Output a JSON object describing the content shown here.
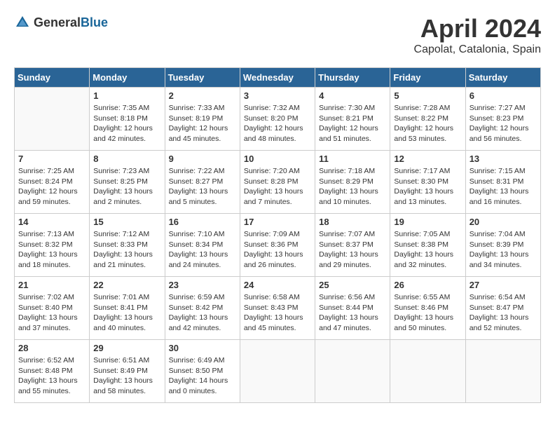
{
  "header": {
    "logo_general": "General",
    "logo_blue": "Blue",
    "month_title": "April 2024",
    "location": "Capolat, Catalonia, Spain"
  },
  "columns": [
    "Sunday",
    "Monday",
    "Tuesday",
    "Wednesday",
    "Thursday",
    "Friday",
    "Saturday"
  ],
  "weeks": [
    [
      {
        "day": "",
        "info": ""
      },
      {
        "day": "1",
        "info": "Sunrise: 7:35 AM\nSunset: 8:18 PM\nDaylight: 12 hours\nand 42 minutes."
      },
      {
        "day": "2",
        "info": "Sunrise: 7:33 AM\nSunset: 8:19 PM\nDaylight: 12 hours\nand 45 minutes."
      },
      {
        "day": "3",
        "info": "Sunrise: 7:32 AM\nSunset: 8:20 PM\nDaylight: 12 hours\nand 48 minutes."
      },
      {
        "day": "4",
        "info": "Sunrise: 7:30 AM\nSunset: 8:21 PM\nDaylight: 12 hours\nand 51 minutes."
      },
      {
        "day": "5",
        "info": "Sunrise: 7:28 AM\nSunset: 8:22 PM\nDaylight: 12 hours\nand 53 minutes."
      },
      {
        "day": "6",
        "info": "Sunrise: 7:27 AM\nSunset: 8:23 PM\nDaylight: 12 hours\nand 56 minutes."
      }
    ],
    [
      {
        "day": "7",
        "info": "Sunrise: 7:25 AM\nSunset: 8:24 PM\nDaylight: 12 hours\nand 59 minutes."
      },
      {
        "day": "8",
        "info": "Sunrise: 7:23 AM\nSunset: 8:25 PM\nDaylight: 13 hours\nand 2 minutes."
      },
      {
        "day": "9",
        "info": "Sunrise: 7:22 AM\nSunset: 8:27 PM\nDaylight: 13 hours\nand 5 minutes."
      },
      {
        "day": "10",
        "info": "Sunrise: 7:20 AM\nSunset: 8:28 PM\nDaylight: 13 hours\nand 7 minutes."
      },
      {
        "day": "11",
        "info": "Sunrise: 7:18 AM\nSunset: 8:29 PM\nDaylight: 13 hours\nand 10 minutes."
      },
      {
        "day": "12",
        "info": "Sunrise: 7:17 AM\nSunset: 8:30 PM\nDaylight: 13 hours\nand 13 minutes."
      },
      {
        "day": "13",
        "info": "Sunrise: 7:15 AM\nSunset: 8:31 PM\nDaylight: 13 hours\nand 16 minutes."
      }
    ],
    [
      {
        "day": "14",
        "info": "Sunrise: 7:13 AM\nSunset: 8:32 PM\nDaylight: 13 hours\nand 18 minutes."
      },
      {
        "day": "15",
        "info": "Sunrise: 7:12 AM\nSunset: 8:33 PM\nDaylight: 13 hours\nand 21 minutes."
      },
      {
        "day": "16",
        "info": "Sunrise: 7:10 AM\nSunset: 8:34 PM\nDaylight: 13 hours\nand 24 minutes."
      },
      {
        "day": "17",
        "info": "Sunrise: 7:09 AM\nSunset: 8:36 PM\nDaylight: 13 hours\nand 26 minutes."
      },
      {
        "day": "18",
        "info": "Sunrise: 7:07 AM\nSunset: 8:37 PM\nDaylight: 13 hours\nand 29 minutes."
      },
      {
        "day": "19",
        "info": "Sunrise: 7:05 AM\nSunset: 8:38 PM\nDaylight: 13 hours\nand 32 minutes."
      },
      {
        "day": "20",
        "info": "Sunrise: 7:04 AM\nSunset: 8:39 PM\nDaylight: 13 hours\nand 34 minutes."
      }
    ],
    [
      {
        "day": "21",
        "info": "Sunrise: 7:02 AM\nSunset: 8:40 PM\nDaylight: 13 hours\nand 37 minutes."
      },
      {
        "day": "22",
        "info": "Sunrise: 7:01 AM\nSunset: 8:41 PM\nDaylight: 13 hours\nand 40 minutes."
      },
      {
        "day": "23",
        "info": "Sunrise: 6:59 AM\nSunset: 8:42 PM\nDaylight: 13 hours\nand 42 minutes."
      },
      {
        "day": "24",
        "info": "Sunrise: 6:58 AM\nSunset: 8:43 PM\nDaylight: 13 hours\nand 45 minutes."
      },
      {
        "day": "25",
        "info": "Sunrise: 6:56 AM\nSunset: 8:44 PM\nDaylight: 13 hours\nand 47 minutes."
      },
      {
        "day": "26",
        "info": "Sunrise: 6:55 AM\nSunset: 8:46 PM\nDaylight: 13 hours\nand 50 minutes."
      },
      {
        "day": "27",
        "info": "Sunrise: 6:54 AM\nSunset: 8:47 PM\nDaylight: 13 hours\nand 52 minutes."
      }
    ],
    [
      {
        "day": "28",
        "info": "Sunrise: 6:52 AM\nSunset: 8:48 PM\nDaylight: 13 hours\nand 55 minutes."
      },
      {
        "day": "29",
        "info": "Sunrise: 6:51 AM\nSunset: 8:49 PM\nDaylight: 13 hours\nand 58 minutes."
      },
      {
        "day": "30",
        "info": "Sunrise: 6:49 AM\nSunset: 8:50 PM\nDaylight: 14 hours\nand 0 minutes."
      },
      {
        "day": "",
        "info": ""
      },
      {
        "day": "",
        "info": ""
      },
      {
        "day": "",
        "info": ""
      },
      {
        "day": "",
        "info": ""
      }
    ]
  ]
}
